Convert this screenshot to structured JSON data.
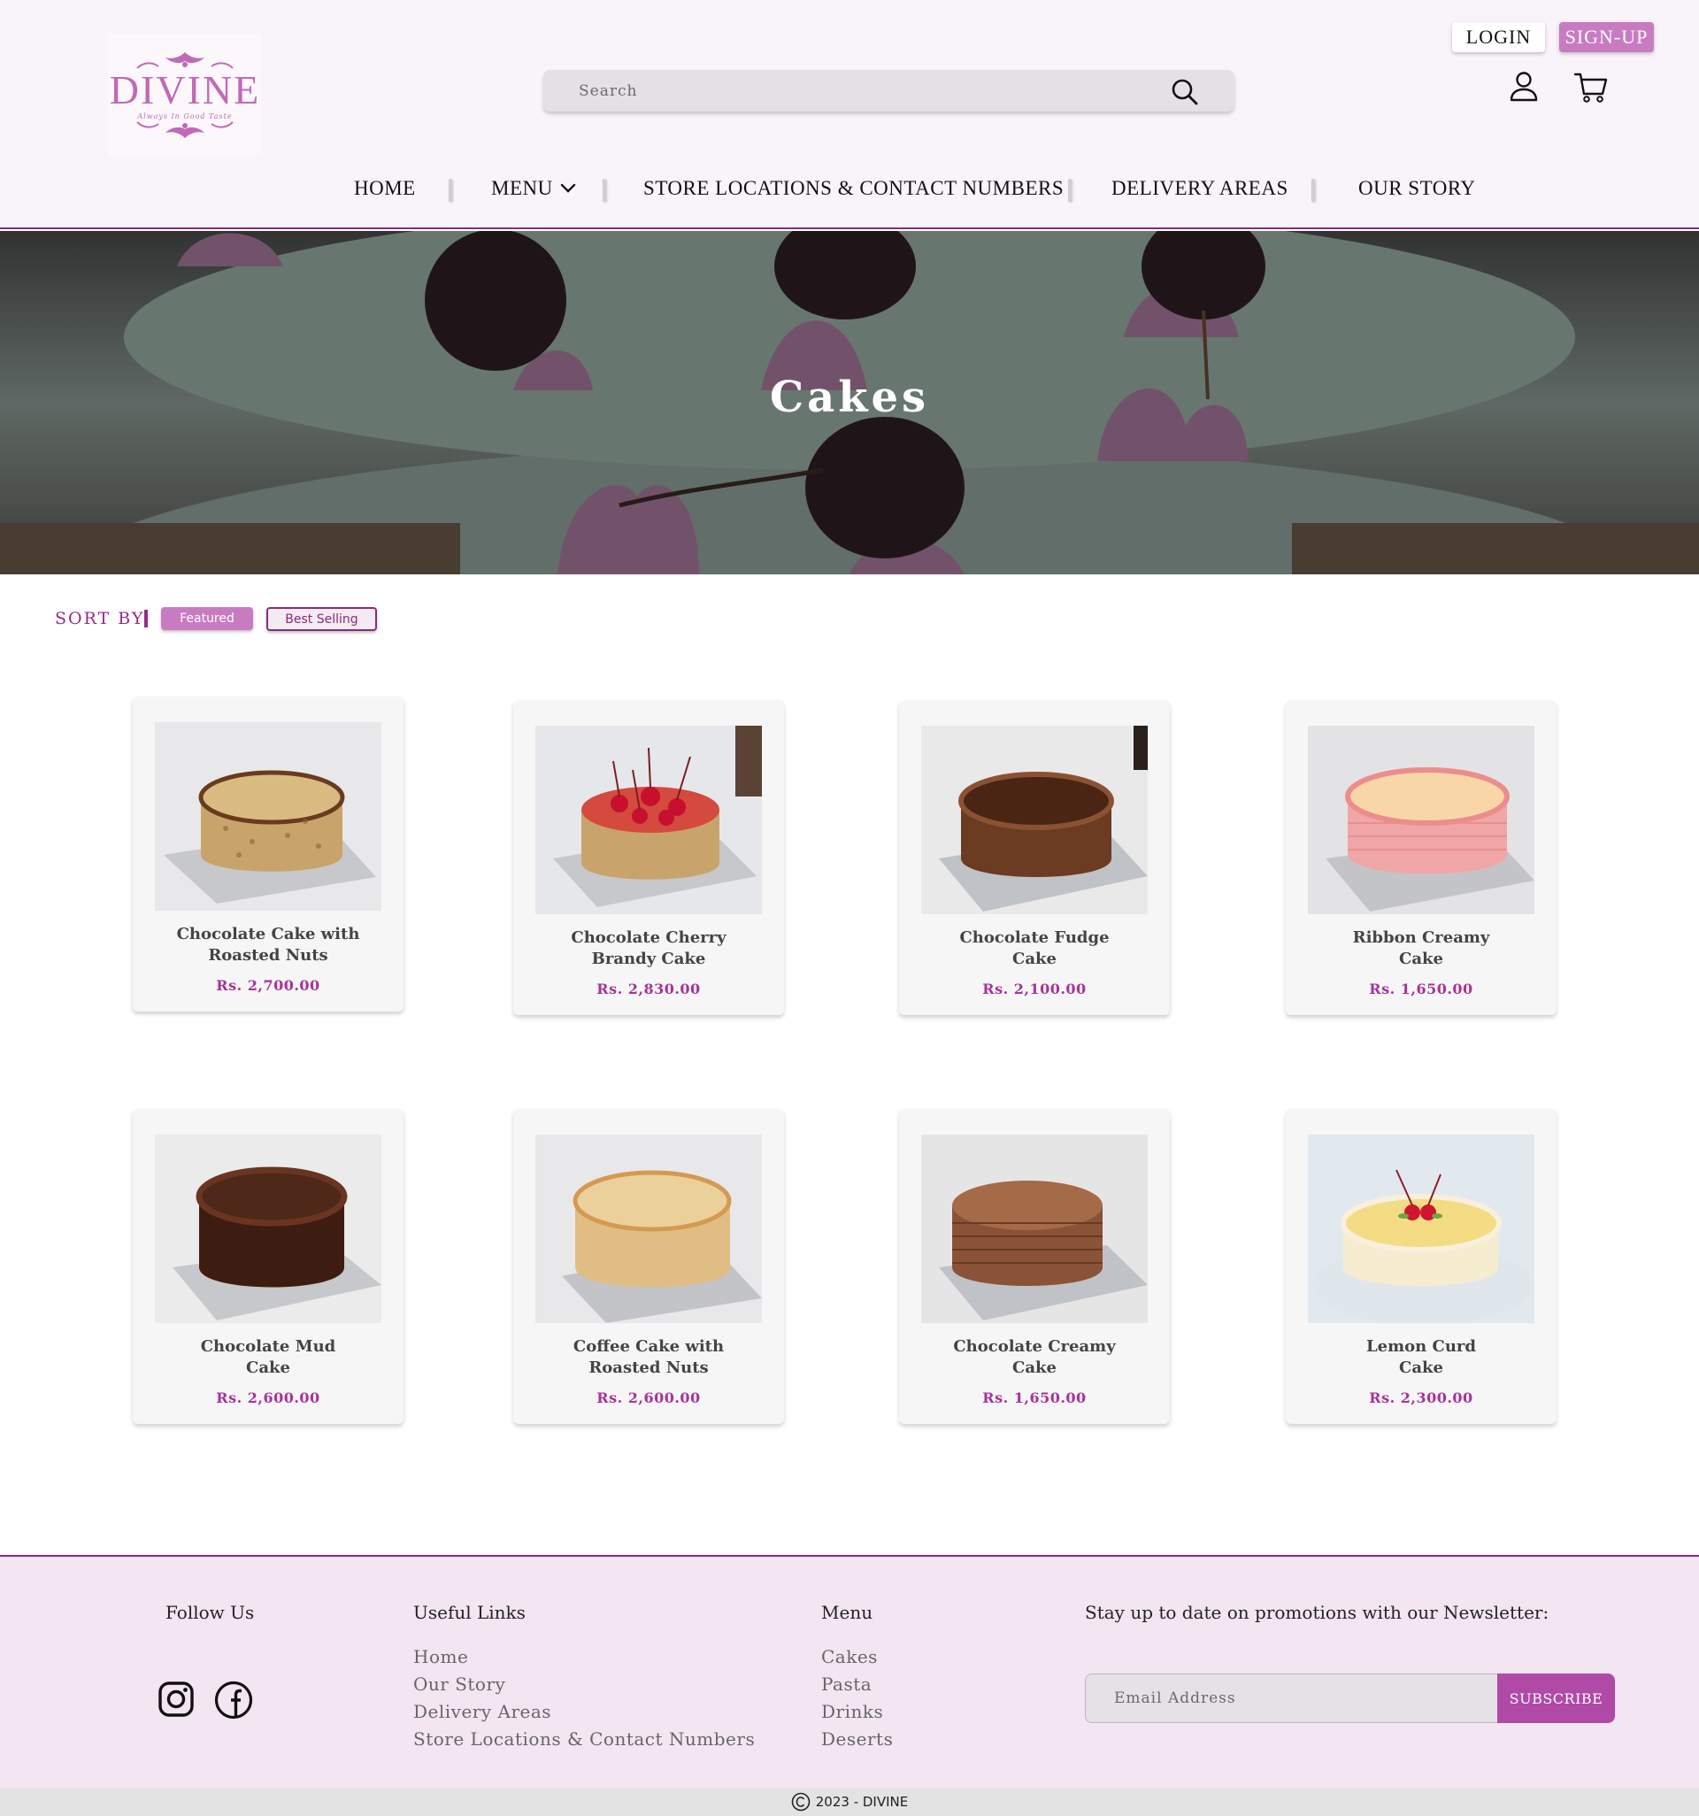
{
  "brand": {
    "name": "DIVINE",
    "tagline": "Always In Good Taste"
  },
  "search": {
    "placeholder": "Search"
  },
  "auth": {
    "login": "LOGIN",
    "signup": "SIGN-UP"
  },
  "nav": {
    "home": "HOME",
    "menu": "MENU",
    "stores": "STORE LOCATIONS  &  CONTACT NUMBERS",
    "delivery": "DELIVERY AREAS",
    "story": "OUR STORY"
  },
  "hero": {
    "title": "Cakes"
  },
  "sort": {
    "label": "SORT BY",
    "featured": "Featured",
    "best_selling": "Best Selling"
  },
  "products": [
    {
      "name": "Chocolate Cake with\nRoasted Nuts",
      "price": "Rs. 2,700.00"
    },
    {
      "name": "Chocolate Cherry\nBrandy Cake",
      "price": "Rs. 2,830.00"
    },
    {
      "name": "Chocolate Fudge\nCake",
      "price": "Rs. 2,100.00"
    },
    {
      "name": "Ribbon Creamy\nCake",
      "price": "Rs. 1,650.00"
    },
    {
      "name": "Chocolate Mud\nCake",
      "price": "Rs. 2,600.00"
    },
    {
      "name": "Coffee Cake with\nRoasted Nuts",
      "price": "Rs. 2,600.00"
    },
    {
      "name": "Chocolate Creamy\nCake",
      "price": "Rs. 1,650.00"
    },
    {
      "name": "Lemon Curd\nCake",
      "price": "Rs. 2,300.00"
    }
  ],
  "footer": {
    "follow": "Follow Us",
    "useful_links": {
      "heading": "Useful Links",
      "items": [
        "Home",
        "Our Story",
        "Delivery Areas",
        "Store Locations & Contact Numbers"
      ]
    },
    "menu": {
      "heading": "Menu",
      "items": [
        "Cakes",
        "Pasta",
        "Drinks",
        "Deserts"
      ]
    },
    "newsletter": {
      "heading": "Stay up to date on promotions with our Newsletter:",
      "placeholder": "Email Address",
      "button": "SUBSCRIBE"
    }
  },
  "copyright": "2023 - DIVINE",
  "colors": {
    "accent": "#c97bc2",
    "brand_dark": "#8a2c78",
    "price": "#a8329a",
    "header_bg": "#f9f3fa",
    "footer_bg": "#f4e5f3"
  }
}
